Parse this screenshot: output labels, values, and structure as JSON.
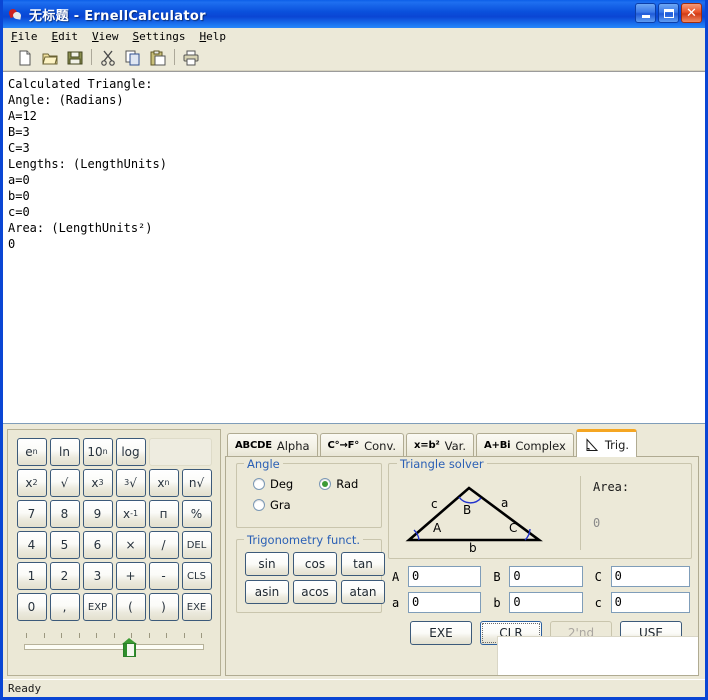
{
  "window": {
    "title": "无标题 - ErnellCalculator",
    "icon": "app-cherry-icon"
  },
  "titlebuttons": {
    "minimize": "minimize-button",
    "maximize": "maximize-button",
    "close": "close-button"
  },
  "menu": {
    "items": [
      {
        "label": "File",
        "accel": "F"
      },
      {
        "label": "Edit",
        "accel": "E"
      },
      {
        "label": "View",
        "accel": "V"
      },
      {
        "label": "Settings",
        "accel": "S"
      },
      {
        "label": "Help",
        "accel": "H"
      }
    ]
  },
  "toolbar": {
    "items": [
      {
        "name": "new-icon"
      },
      {
        "name": "open-icon"
      },
      {
        "name": "save-icon"
      },
      {
        "name": "separator"
      },
      {
        "name": "cut-icon"
      },
      {
        "name": "copy-icon"
      },
      {
        "name": "paste-icon"
      },
      {
        "name": "separator"
      },
      {
        "name": "print-icon"
      }
    ]
  },
  "output": {
    "text": "Calculated Triangle:\nAngle: (Radians)\nA=12\nB=3\nC=3\nLengths: (LengthUnits)\na=0\nb=0\nc=0\nArea: (LengthUnits²)\n0"
  },
  "keypad": {
    "rows": [
      [
        {
          "label": "e",
          "sup": "n"
        },
        {
          "label": "ln"
        },
        {
          "label": "10",
          "sup": "n"
        },
        {
          "label": "log"
        },
        {
          "label": "",
          "blank": true
        }
      ],
      [
        {
          "label": "x",
          "sup": "2"
        },
        {
          "label": "√"
        },
        {
          "label": "x",
          "sup": "3"
        },
        {
          "pre": "3",
          "label": "√"
        },
        {
          "label": "x",
          "sup": "n"
        },
        {
          "label": "n",
          "suffix": "√"
        }
      ],
      [
        {
          "label": "7"
        },
        {
          "label": "8"
        },
        {
          "label": "9"
        },
        {
          "label": "x",
          "sup": "-1"
        },
        {
          "label": "п"
        },
        {
          "label": "%"
        }
      ],
      [
        {
          "label": "4"
        },
        {
          "label": "5"
        },
        {
          "label": "6"
        },
        {
          "label": "×"
        },
        {
          "label": "/"
        },
        {
          "label": "DEL",
          "small": true
        }
      ],
      [
        {
          "label": "1"
        },
        {
          "label": "2"
        },
        {
          "label": "3"
        },
        {
          "label": "+"
        },
        {
          "label": "-"
        },
        {
          "label": "CLS",
          "small": true
        }
      ],
      [
        {
          "label": "0"
        },
        {
          "label": ","
        },
        {
          "label": "EXP",
          "small": true
        },
        {
          "label": "("
        },
        {
          "label": ")"
        },
        {
          "label": "EXE",
          "small": true
        }
      ]
    ],
    "slider": {
      "name": "precision-slider",
      "value": 55,
      "ticks": 11
    }
  },
  "tabs": [
    {
      "icon": "ABCDE",
      "label": "Alpha",
      "active": false,
      "name": "tab-alpha"
    },
    {
      "icon": "C°→F°",
      "label": "Conv.",
      "active": false,
      "name": "tab-conv"
    },
    {
      "icon": "x=b²",
      "label": "Var.",
      "active": false,
      "name": "tab-var"
    },
    {
      "icon": "A+Bi",
      "label": "Complex",
      "active": false,
      "name": "tab-complex"
    },
    {
      "icon": "triangle-icon",
      "label": "Trig.",
      "active": true,
      "name": "tab-trig"
    }
  ],
  "angle": {
    "legend": "Angle",
    "options": [
      {
        "label": "Deg",
        "selected": false
      },
      {
        "label": "Rad",
        "selected": true
      },
      {
        "label": "Gra",
        "selected": false
      }
    ]
  },
  "trigfunctions": {
    "legend": "Trigonometry funct.",
    "buttons": [
      "sin",
      "cos",
      "tan",
      "asin",
      "acos",
      "atan"
    ]
  },
  "solver": {
    "legend": "Triangle solver",
    "diagram": {
      "angles": [
        "A",
        "B",
        "C"
      ],
      "sides": [
        "a",
        "b",
        "c"
      ]
    },
    "area_label": "Area:",
    "area_value": "0",
    "fields": [
      {
        "label": "A",
        "value": "0",
        "name": "angle-a-input"
      },
      {
        "label": "B",
        "value": "0",
        "name": "angle-b-input"
      },
      {
        "label": "C",
        "value": "0",
        "name": "angle-c-input"
      },
      {
        "label": "a",
        "value": "0",
        "name": "side-a-input"
      },
      {
        "label": "b",
        "value": "0",
        "name": "side-b-input"
      },
      {
        "label": "c",
        "value": "0",
        "name": "side-c-input"
      }
    ],
    "buttons": [
      {
        "label": "EXE",
        "state": "normal",
        "name": "exe-button"
      },
      {
        "label": "CLR",
        "state": "focus",
        "name": "clr-button"
      },
      {
        "label": "2'nd",
        "state": "disabled",
        "name": "second-button"
      },
      {
        "label": "USE",
        "state": "normal",
        "name": "use-button"
      }
    ]
  },
  "statusbar": {
    "text": "Ready"
  },
  "colors": {
    "titlebar_blue": "#0a46d4",
    "face": "#ece9d8",
    "accent_orange": "#f5a623",
    "group_label_blue": "#2b60b5",
    "radio_green": "#3c9a36"
  }
}
